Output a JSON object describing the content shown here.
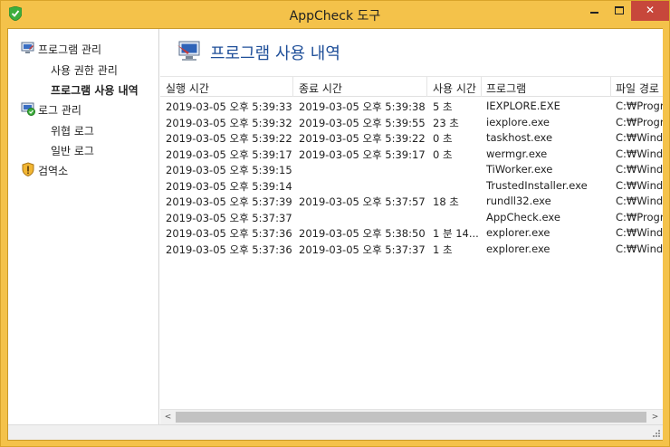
{
  "window": {
    "title": "AppCheck 도구",
    "minimize_icon": "minimize-icon",
    "maximize_icon": "maximize-icon",
    "close_icon": "close-icon",
    "close_glyph": "✕"
  },
  "sidebar": {
    "items": [
      {
        "label": "프로그램 관리",
        "icon": "program-manage-icon",
        "level": 0
      },
      {
        "label": "사용 권한 관리",
        "level": 1
      },
      {
        "label": "프로그램 사용 내역",
        "level": 1,
        "selected": true
      },
      {
        "label": "로그 관리",
        "icon": "log-manage-icon",
        "level": 0
      },
      {
        "label": "위협 로그",
        "level": 1
      },
      {
        "label": "일반 로그",
        "level": 1
      },
      {
        "label": "검역소",
        "icon": "quarantine-shield-icon",
        "level": 0
      }
    ]
  },
  "main": {
    "title": "프로그램 사용 내역",
    "title_icon": "program-usage-monitor-icon",
    "table": {
      "columns": [
        "실행 시간",
        "종료 시간",
        "사용 시간",
        "프로그램",
        "파일 경로"
      ],
      "rows": [
        [
          "2019-03-05 오후 5:39:33",
          "2019-03-05 오후 5:39:38",
          "5 초",
          "IEXPLORE.EXE",
          "C:₩Program"
        ],
        [
          "2019-03-05 오후 5:39:32",
          "2019-03-05 오후 5:39:55",
          "23 초",
          "iexplore.exe",
          "C:₩Program"
        ],
        [
          "2019-03-05 오후 5:39:22",
          "2019-03-05 오후 5:39:22",
          "0 초",
          "taskhost.exe",
          "C:₩Window"
        ],
        [
          "2019-03-05 오후 5:39:17",
          "2019-03-05 오후 5:39:17",
          "0 초",
          "wermgr.exe",
          "C:₩Window"
        ],
        [
          "2019-03-05 오후 5:39:15",
          "",
          "",
          "TiWorker.exe",
          "C:₩Window"
        ],
        [
          "2019-03-05 오후 5:39:14",
          "",
          "",
          "TrustedInstaller.exe",
          "C:₩Window"
        ],
        [
          "2019-03-05 오후 5:37:39",
          "2019-03-05 오후 5:37:57",
          "18 초",
          "rundll32.exe",
          "C:₩Window"
        ],
        [
          "2019-03-05 오후 5:37:37",
          "",
          "",
          "AppCheck.exe",
          "C:₩Program"
        ],
        [
          "2019-03-05 오후 5:37:36",
          "2019-03-05 오후 5:38:50",
          "1 분 14...",
          "explorer.exe",
          "C:₩Window"
        ],
        [
          "2019-03-05 오후 5:37:36",
          "2019-03-05 오후 5:37:37",
          "1 초",
          "explorer.exe",
          "C:₩Window"
        ]
      ]
    }
  },
  "scrollbar": {
    "left_glyph": "<",
    "right_glyph": ">"
  },
  "colors": {
    "titlebar": "#f4c24a",
    "close_button": "#c7473b",
    "header_title": "#1f4f99"
  }
}
